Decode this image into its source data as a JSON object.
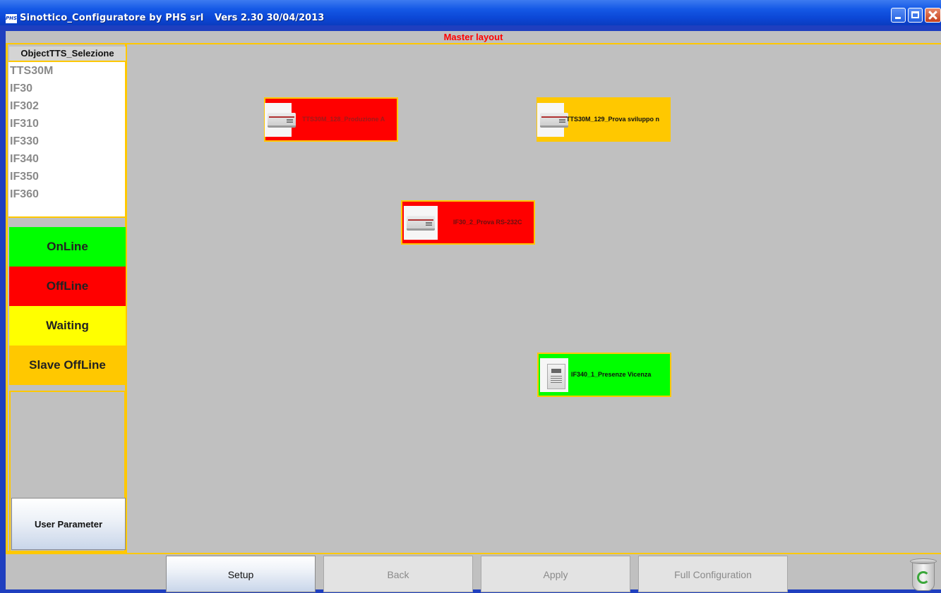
{
  "titlebar": {
    "icon_text": "PHS",
    "title": "Sinottico_Configuratore by PHS srl",
    "version": "Vers 2.30  30/04/2013"
  },
  "header": {
    "label": "Master layout"
  },
  "sidebar": {
    "selection_header": "ObjectTTS_Selezione",
    "items": [
      "TTS30M",
      "IF30",
      "IF302",
      "IF310",
      "IF330",
      "IF340",
      "IF350",
      "IF360"
    ],
    "legend": [
      {
        "label": "OnLine",
        "color": "#00ff00"
      },
      {
        "label": "OffLine",
        "color": "#ff0000"
      },
      {
        "label": "Waiting",
        "color": "#ffff00"
      },
      {
        "label": "Slave OffLine",
        "color": "#ffc800"
      }
    ],
    "user_parameter_label": "User Parameter"
  },
  "devices": [
    {
      "label": "TTS30M_128_Produzione A",
      "status": "OffLine",
      "color": "#ff0000"
    },
    {
      "label": "TTS30M_129_Prova sviluppo n",
      "status": "Slave OffLine",
      "color": "#ffc800"
    },
    {
      "label": "IF30_2_Prova RS-232C",
      "status": "OffLine",
      "color": "#ff0000"
    },
    {
      "label": "IF340_1_Presenze Vicenza",
      "status": "OnLine",
      "color": "#00ff00"
    }
  ],
  "bottom": {
    "setup_label": "Setup",
    "back_label": "Back",
    "apply_label": "Apply",
    "full_config_label": "Full Configuration"
  }
}
